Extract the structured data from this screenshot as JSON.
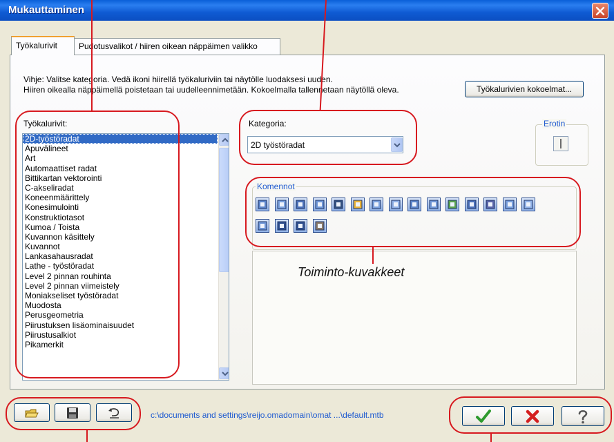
{
  "window": {
    "title": "Mukauttaminen"
  },
  "tabs": [
    "Työkalurivit",
    "Pudotusvalikot / hiiren oikean näppäimen valikko"
  ],
  "hint": {
    "line1": "Vihje:  Valitse kategoria. Vedä ikoni hiirellä työkaluriviin tai näytölle luodaksesi uuden.",
    "line2": "Hiiren oikealla näppäimellä poistetaan tai uudelleennimetään.  Kokoelmalla tallennetaan näytöllä oleva."
  },
  "collection_button": "Työkalurivien kokoelmat...",
  "toolbars": {
    "label": "Työkalurivit:",
    "selected": "2D-työstöradat",
    "items": [
      "2D-työstöradat",
      "Apuvälineet",
      "Art",
      "Automaattiset radat",
      "Bittikartan vektorointi",
      "C-akseliradat",
      "Koneenmäärittely",
      "Konesimulointi",
      "Konstruktiotasot",
      "Kumoa / Toista",
      "Kuvannon käsittely",
      "Kuvannot",
      "Lankasahausradat",
      "Lathe - työstöradat",
      "Level 2 pinnan rouhinta",
      "Level 2 pinnan viimeistely",
      "Moniakseliset työstöradat",
      "Muodosta",
      "Perusgeometria",
      "Piirustuksen lisäominaisuudet",
      "Piirustusalkiot",
      "Pikamerkit"
    ]
  },
  "category": {
    "label": "Kategoria:",
    "value": "2D työstöradat"
  },
  "separator": {
    "label": "Erotin"
  },
  "commands": {
    "label": "Komennot",
    "icons": [
      "contour-toolpath-icon",
      "pocket-toolpath-icon",
      "facing-toolpath-icon",
      "slot-mill-icon",
      "drill-icon",
      "tap-icon",
      "circle-mill-icon",
      "thread-mill-icon",
      "helix-bore-icon",
      "auto-drill-icon",
      "chamfer-icon",
      "engraving-icon",
      "solid-toolpath-icon",
      "transform-toolpath-icon",
      "feature-based-machining-icon",
      "trim-toolpath-icon",
      "block-drill-icon",
      "high-speed-toolpath-icon",
      "model-chamfer-icon"
    ]
  },
  "callout_text": "Toiminto-kuvakkeet",
  "bottom": {
    "path": "c:\\documents and settings\\reijo.omadomain\\omat ...\\default.mtb",
    "buttons": [
      "open-folder-icon",
      "save-icon",
      "undo-icon"
    ],
    "actions": [
      "ok-check-icon",
      "cancel-x-icon",
      "help-icon"
    ]
  },
  "colors": {
    "accent": "#316ac5",
    "annotation": "#d7191f",
    "title_bar": "#0a5fd8",
    "dialog": "#ece9d8"
  }
}
